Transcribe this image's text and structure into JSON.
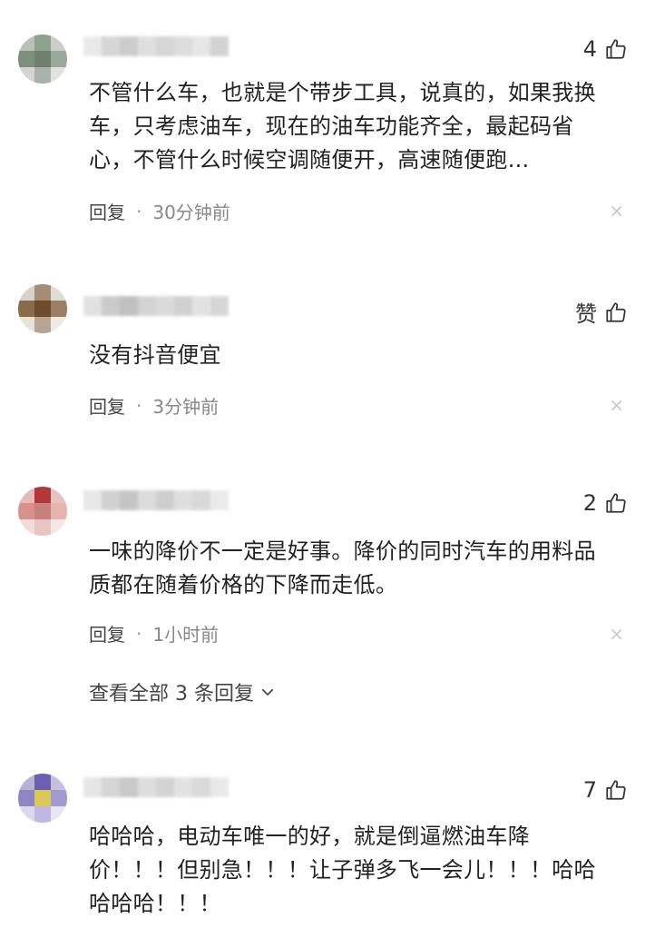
{
  "comments": [
    {
      "likes": "4",
      "text_lines": [
        "不管什么车，也就是个带步工具，说真的，如果我换",
        "车，只考虑油车，现在的油车功能齐全，最起码省",
        "心，不管什么时候空调随便开，高速随便跑..."
      ],
      "reply": "回复",
      "dot": "·",
      "time": "30分钟前",
      "close": "×"
    },
    {
      "likes": "赞",
      "text_lines": [
        "没有抖音便宜"
      ],
      "reply": "回复",
      "dot": "·",
      "time": "3分钟前",
      "close": "×"
    },
    {
      "likes": "2",
      "text_lines": [
        "一味的降价不一定是好事。降价的同时汽车的用料品",
        "质都在随着价格的下降而走低。"
      ],
      "reply": "回复",
      "dot": "·",
      "time": "1小时前",
      "close": "×"
    },
    {
      "likes": "7",
      "text_lines": [
        "哈哈哈，电动车唯一的好，就是倒逼燃油车降",
        "价！！！但别急！！！让子弹多飞一会儿！！！哈哈",
        "哈哈哈！！！"
      ]
    }
  ],
  "view_all_replies": "查看全部 3 条回复",
  "icons": {
    "like": "thumbs-up-icon",
    "close": "close-icon",
    "expand": "chevron-down-icon"
  }
}
